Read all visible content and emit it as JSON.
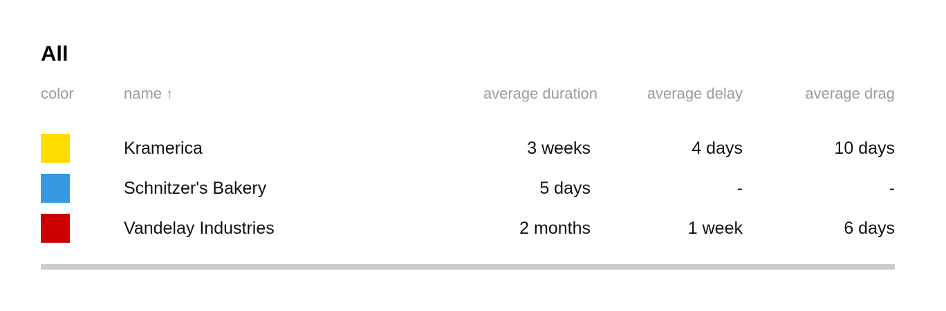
{
  "title": "All",
  "columns": {
    "color": "color",
    "name": "name",
    "name_sort_icon": "↑",
    "duration": "average duration",
    "delay": "average delay",
    "drag": "average drag"
  },
  "rows": [
    {
      "color": "#ffdd00",
      "name": "Kramerica",
      "duration": "3 weeks",
      "delay": "4 days",
      "drag": "10 days"
    },
    {
      "color": "#3499df",
      "name": "Schnitzer's Bakery",
      "duration": "5 days",
      "delay": "-",
      "drag": "-"
    },
    {
      "color": "#cc0000",
      "name": "Vandelay Industries",
      "duration": "2 months",
      "delay": "1 week",
      "drag": "6 days"
    }
  ],
  "colors": {
    "header_text": "#9b9b9b",
    "footer_bar": "#cccccc"
  }
}
